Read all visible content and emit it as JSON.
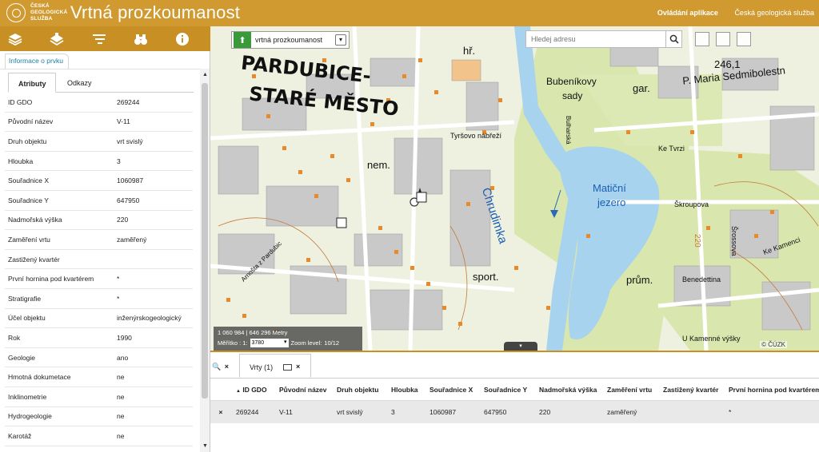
{
  "header": {
    "logo_lines": [
      "ČESKÁ",
      "GEOLOGICKÁ",
      "SLUŽBA"
    ],
    "title": "Vrtná prozkoumanost",
    "links": [
      "Ovládání aplikace",
      "Česká geologická služba"
    ]
  },
  "toolbar": {
    "icons": [
      "layers-icon",
      "basemap-icon",
      "legend-icon",
      "binoculars-icon",
      "info-icon"
    ]
  },
  "panel": {
    "tab_label": "Informace o prvku",
    "subtabs": [
      "Atributy",
      "Odkazy"
    ],
    "attributes": [
      {
        "key": "ID GDO",
        "value": "269244"
      },
      {
        "key": "Původní název",
        "value": "V-11"
      },
      {
        "key": "Druh objektu",
        "value": "vrt svislý"
      },
      {
        "key": "Hloubka",
        "value": "3"
      },
      {
        "key": "Souřadnice X",
        "value": "1060987"
      },
      {
        "key": "Souřadnice Y",
        "value": "647950"
      },
      {
        "key": "Nadmořská výška",
        "value": "220"
      },
      {
        "key": "Zaměření vrtu",
        "value": "zaměřený"
      },
      {
        "key": "Zastižený kvartér",
        "value": ""
      },
      {
        "key": "První hornina pod kvartérem",
        "value": "*"
      },
      {
        "key": "Stratigrafie",
        "value": "*"
      },
      {
        "key": "Účel objektu",
        "value": "inženýrskogeologický"
      },
      {
        "key": "Rok",
        "value": "1990"
      },
      {
        "key": "Geologie",
        "value": "ano"
      },
      {
        "key": "Hmotná dokumetace",
        "value": "ne"
      },
      {
        "key": "Inklinometrie",
        "value": "ne"
      },
      {
        "key": "Hydrogeologie",
        "value": "ne"
      },
      {
        "key": "Karotáž",
        "value": "ne"
      }
    ]
  },
  "map": {
    "layer_select": "vrtná prozkoumanost",
    "search_placeholder": "Hledej adresu",
    "coords_readout": "1 060 984 | 646 296 Metry",
    "scale_label": "Měřítko : 1:",
    "scale_value": "3780",
    "zoom_label": "Zoom level:",
    "zoom_value": "10/12",
    "copyright": "© ČÚZK",
    "labels": {
      "city": "PARDUBICE-",
      "district": "STARÉ MĚSTO",
      "river": "Chrudimka",
      "lake_1": "Matiční",
      "lake_2": "jezero",
      "park_1": "Bubeníkovy",
      "park_2": "sady",
      "street_1": "Tyršovo nábřeží",
      "street_2": "P. Maria Sedmibolestn",
      "street_3": "Ke Tvrzi",
      "street_4": "Škroupova",
      "street_5": "Benedettina",
      "street_6": "U Kamenné výšky",
      "street_7": "Šrossova",
      "street_8": "Ke Kamenci",
      "street_9": "Bulharská",
      "street_10": "Arnošta z Pardubic",
      "nem": "nem.",
      "hr": "hř.",
      "sport": "sport.",
      "prum": "prům.",
      "gar": "gar.",
      "num_1": "246,1",
      "num_2": "220"
    },
    "colors": {
      "river": "#a7d3ee",
      "green": "#d9e6ad",
      "building": "#c9c9c9",
      "borehole": "#e88a2a",
      "header": "#d09a30"
    }
  },
  "bottom": {
    "tab_label": "Vrty (1)",
    "columns": [
      "ID GDO",
      "Původní název",
      "Druh objektu",
      "Hloubka",
      "Souřadnice X",
      "Souřadnice Y",
      "Nadmořská výška",
      "Zaměření vrtu",
      "Zastižený kvartér",
      "První hornina pod kvartérem"
    ],
    "sort_indicator": "▲",
    "rows": [
      {
        "remove": "×",
        "cells": [
          "269244",
          "V-11",
          "vrt svislý",
          "3",
          "1060987",
          "647950",
          "220",
          "zaměřený",
          "",
          "*"
        ]
      }
    ]
  }
}
